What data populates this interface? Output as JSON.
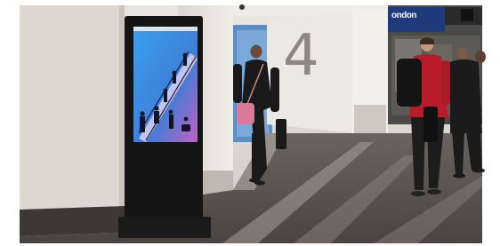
{
  "scene": {
    "kiosk_screen": {
      "header": "",
      "headline": "",
      "body": ""
    },
    "platform_number": "4",
    "shop_sign": "ondon"
  },
  "colors": {
    "wall": "#e6e1db",
    "floor": "#5b5450",
    "kiosk": "#141414",
    "screen": "#2f8be6",
    "jacket_red": "#b81c2a"
  }
}
